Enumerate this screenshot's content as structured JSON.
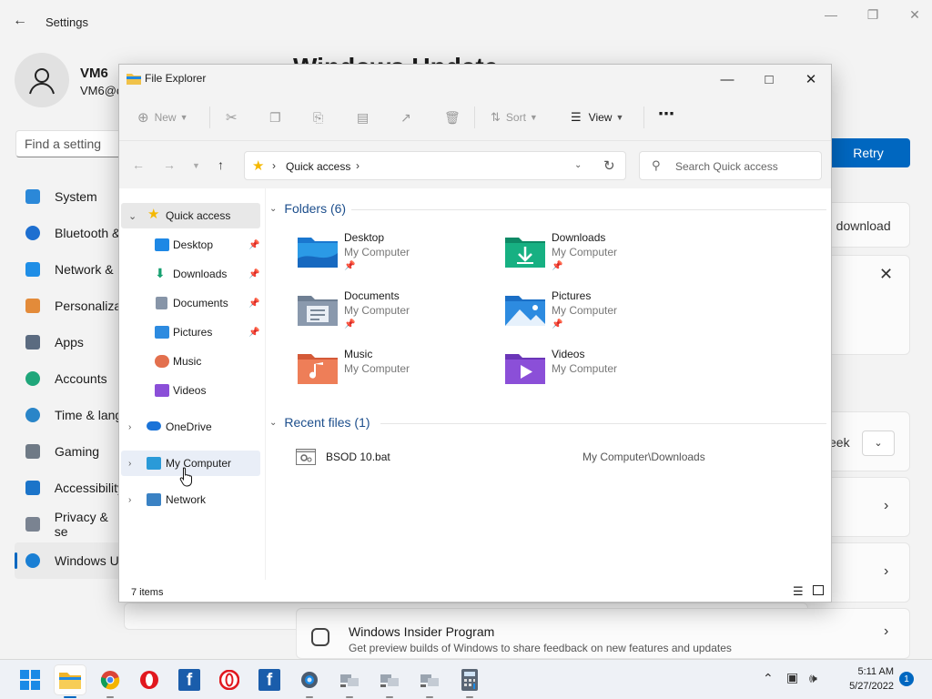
{
  "settings": {
    "title": "Settings",
    "user_name": "VM6",
    "user_email": "VM6@c",
    "search_placeholder": "Find a setting",
    "heading": "Windows Update",
    "nav": [
      {
        "label": "System"
      },
      {
        "label": "Bluetooth &"
      },
      {
        "label": "Network &"
      },
      {
        "label": "Personaliza"
      },
      {
        "label": "Apps"
      },
      {
        "label": "Accounts"
      },
      {
        "label": "Time & lang"
      },
      {
        "label": "Gaming"
      },
      {
        "label": "Accessibility"
      },
      {
        "label": "Privacy & se"
      },
      {
        "label": "Windows U"
      }
    ],
    "retry_label": "Retry",
    "download_text": "g download",
    "week_text": "eek",
    "insider_title": "Windows Insider Program",
    "insider_desc": "Get preview builds of Windows to share feedback on new features and updates"
  },
  "explorer": {
    "title": "File Explorer",
    "toolbar": {
      "new_label": "New",
      "sort_label": "Sort",
      "view_label": "View"
    },
    "address": "Quick access",
    "search_placeholder": "Search Quick access",
    "nav": [
      {
        "label": "Quick access"
      },
      {
        "label": "Desktop"
      },
      {
        "label": "Downloads"
      },
      {
        "label": "Documents"
      },
      {
        "label": "Pictures"
      },
      {
        "label": "Music"
      },
      {
        "label": "Videos"
      },
      {
        "label": "OneDrive"
      },
      {
        "label": "My Computer"
      },
      {
        "label": "Network"
      }
    ],
    "folders_heading": "Folders (6)",
    "folders": [
      {
        "name": "Desktop",
        "location": "My Computer"
      },
      {
        "name": "Downloads",
        "location": "My Computer"
      },
      {
        "name": "Documents",
        "location": "My Computer"
      },
      {
        "name": "Pictures",
        "location": "My Computer"
      },
      {
        "name": "Music",
        "location": "My Computer"
      },
      {
        "name": "Videos",
        "location": "My Computer"
      }
    ],
    "recent_heading": "Recent files (1)",
    "recent": [
      {
        "name": "BSOD 10.bat",
        "path": "My Computer\\Downloads"
      }
    ],
    "status_items": "7 items"
  },
  "taskbar": {
    "time": "5:11 AM",
    "date": "5/27/2022",
    "notification_count": "1"
  },
  "colors": {
    "accent": "#0067c0",
    "folder": "#f0c24a"
  }
}
